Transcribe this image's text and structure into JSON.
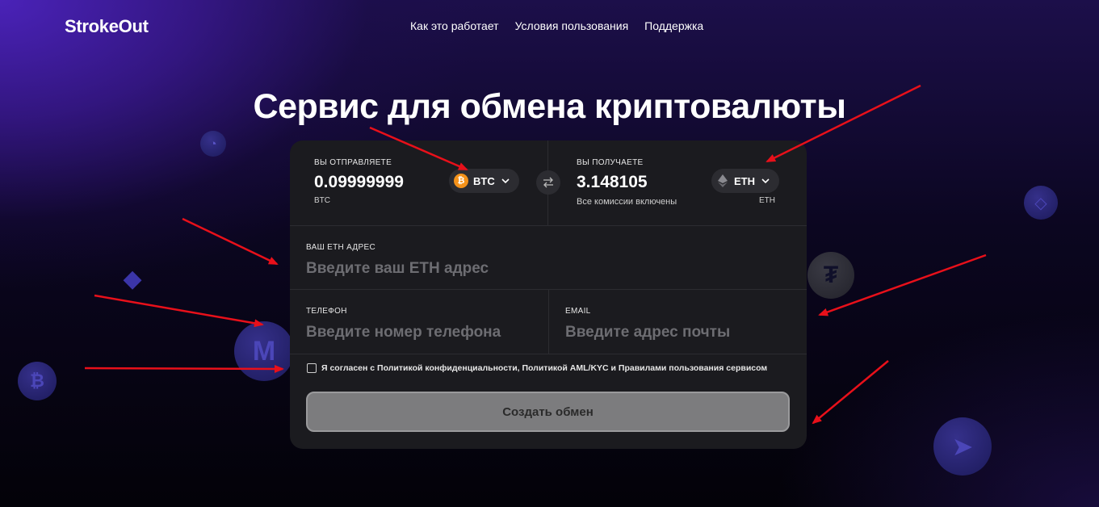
{
  "header": {
    "logo": "StrokeOut",
    "nav": [
      "Как это работает",
      "Условия пользования",
      "Поддержка"
    ]
  },
  "hero": {
    "title": "Сервис для обмена криптовалюты"
  },
  "exchange": {
    "send": {
      "label": "ВЫ ОТПРАВЛЯЕТЕ",
      "amount": "0.09999999",
      "currency_note": "BTC",
      "currency": "BTC",
      "icon": "bitcoin-icon"
    },
    "receive": {
      "label": "ВЫ ПОЛУЧАЕТЕ",
      "amount": "3.148105",
      "fee_note": "Все комиссии включены",
      "currency_note": "ETH",
      "currency": "ETH",
      "icon": "ethereum-icon"
    },
    "address": {
      "label": "ВАШ ETH АДРЕС",
      "placeholder": "Введите ваш ETH адрес"
    },
    "phone": {
      "label": "ТЕЛЕФОН",
      "placeholder": "Введите номер телефона"
    },
    "email": {
      "label": "EMAIL",
      "placeholder": "Введите адрес почты"
    },
    "agreement": "Я согласен с Политикой конфиденциальности, Политикой AML/KYC  и Правилами пользования сервисом",
    "submit_label": "Создать обмен"
  },
  "colors": {
    "accent_purple": "#4a22b8",
    "card_bg": "#1b1b1f",
    "annotation_arrow": "#e8101a",
    "btc_orange": "#f4921a"
  }
}
